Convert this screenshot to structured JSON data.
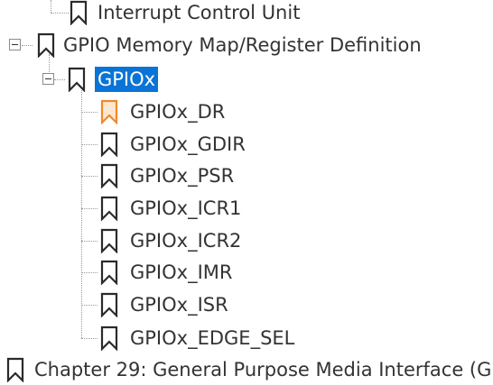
{
  "colors": {
    "selection": "#0a74d6",
    "bookmark_outline": "#2b2b2b",
    "bookmark_active": "#f08a2a",
    "text": "#333333"
  },
  "tree": {
    "items": [
      {
        "label": "Interrupt Control Unit",
        "icon": "bookmark-icon",
        "expanded": null
      },
      {
        "label": "GPIO Memory Map/Register Definition",
        "icon": "bookmark-icon",
        "expanded": true
      },
      {
        "label": "GPIOx",
        "icon": "bookmark-icon",
        "expanded": true,
        "selected": true
      },
      {
        "label": "GPIOx_DR",
        "icon": "bookmark-icon",
        "current": true
      },
      {
        "label": "GPIOx_GDIR",
        "icon": "bookmark-icon"
      },
      {
        "label": "GPIOx_PSR",
        "icon": "bookmark-icon"
      },
      {
        "label": "GPIOx_ICR1",
        "icon": "bookmark-icon"
      },
      {
        "label": "GPIOx_ICR2",
        "icon": "bookmark-icon"
      },
      {
        "label": "GPIOx_IMR",
        "icon": "bookmark-icon"
      },
      {
        "label": "GPIOx_ISR",
        "icon": "bookmark-icon"
      },
      {
        "label": "GPIOx_EDGE_SEL",
        "icon": "bookmark-icon"
      },
      {
        "label": "Chapter 29: General Purpose Media Interface (G",
        "icon": "bookmark-icon"
      }
    ]
  }
}
